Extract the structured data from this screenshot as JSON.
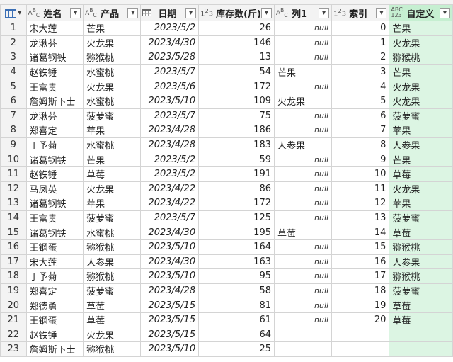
{
  "header": {
    "columns": [
      {
        "label": "姓名",
        "type_icon": "ABC",
        "type_name": "text-type-icon"
      },
      {
        "label": "产品",
        "type_icon": "ABC",
        "type_name": "text-type-icon"
      },
      {
        "label": "日期",
        "type_icon": "calendar",
        "type_name": "date-type-icon"
      },
      {
        "label": "库存数(斤)",
        "type_icon": "123",
        "type_name": "number-type-icon"
      },
      {
        "label": "列1",
        "type_icon": "ABC",
        "type_name": "text-type-icon"
      },
      {
        "label": "索引",
        "type_icon": "123",
        "type_name": "number-type-icon"
      },
      {
        "label": "自定义",
        "type_icon": "ABC123",
        "type_name": "any-type-icon"
      }
    ]
  },
  "null_text": "null",
  "rows": [
    {
      "n": "1",
      "name": "宋大莲",
      "product": "芒果",
      "date": "2023/5/2",
      "qty": "26",
      "col1": "null",
      "idx": "0",
      "custom": "芒果"
    },
    {
      "n": "2",
      "name": "龙湫芬",
      "product": "火龙果",
      "date": "2023/4/30",
      "qty": "146",
      "col1": "null",
      "idx": "1",
      "custom": "火龙果"
    },
    {
      "n": "3",
      "name": "诸葛钢铁",
      "product": "猕猴桃",
      "date": "2023/5/28",
      "qty": "13",
      "col1": "null",
      "idx": "2",
      "custom": "猕猴桃"
    },
    {
      "n": "4",
      "name": "赵铁锤",
      "product": "水蜜桃",
      "date": "2023/5/7",
      "qty": "54",
      "col1": "芒果",
      "idx": "3",
      "custom": "芒果"
    },
    {
      "n": "5",
      "name": "王富贵",
      "product": "火龙果",
      "date": "2023/5/6",
      "qty": "172",
      "col1": "null",
      "idx": "4",
      "custom": "火龙果"
    },
    {
      "n": "6",
      "name": "詹姆斯下士",
      "product": "水蜜桃",
      "date": "2023/5/10",
      "qty": "109",
      "col1": "火龙果",
      "idx": "5",
      "custom": "火龙果"
    },
    {
      "n": "7",
      "name": "龙湫芬",
      "product": "菠萝蜜",
      "date": "2023/5/7",
      "qty": "75",
      "col1": "null",
      "idx": "6",
      "custom": "菠萝蜜"
    },
    {
      "n": "8",
      "name": "郑喜定",
      "product": "苹果",
      "date": "2023/4/28",
      "qty": "186",
      "col1": "null",
      "idx": "7",
      "custom": "苹果"
    },
    {
      "n": "9",
      "name": "于予菊",
      "product": "水蜜桃",
      "date": "2023/4/28",
      "qty": "183",
      "col1": "人参果",
      "idx": "8",
      "custom": "人参果"
    },
    {
      "n": "10",
      "name": "诸葛钢铁",
      "product": "芒果",
      "date": "2023/5/2",
      "qty": "59",
      "col1": "null",
      "idx": "9",
      "custom": "芒果"
    },
    {
      "n": "11",
      "name": "赵铁锤",
      "product": "草莓",
      "date": "2023/5/2",
      "qty": "191",
      "col1": "null",
      "idx": "10",
      "custom": "草莓"
    },
    {
      "n": "12",
      "name": "马凤英",
      "product": "火龙果",
      "date": "2023/4/22",
      "qty": "86",
      "col1": "null",
      "idx": "11",
      "custom": "火龙果"
    },
    {
      "n": "13",
      "name": "诸葛钢铁",
      "product": "苹果",
      "date": "2023/4/22",
      "qty": "172",
      "col1": "null",
      "idx": "12",
      "custom": "苹果"
    },
    {
      "n": "14",
      "name": "王富贵",
      "product": "菠萝蜜",
      "date": "2023/5/7",
      "qty": "125",
      "col1": "null",
      "idx": "13",
      "custom": "菠萝蜜"
    },
    {
      "n": "15",
      "name": "诸葛钢铁",
      "product": "水蜜桃",
      "date": "2023/4/30",
      "qty": "195",
      "col1": "草莓",
      "idx": "14",
      "custom": "草莓"
    },
    {
      "n": "16",
      "name": "王钢蛋",
      "product": "猕猴桃",
      "date": "2023/5/10",
      "qty": "164",
      "col1": "null",
      "idx": "15",
      "custom": "猕猴桃"
    },
    {
      "n": "17",
      "name": "宋大莲",
      "product": "人参果",
      "date": "2023/4/30",
      "qty": "163",
      "col1": "null",
      "idx": "16",
      "custom": "人参果"
    },
    {
      "n": "18",
      "name": "于予菊",
      "product": "猕猴桃",
      "date": "2023/5/10",
      "qty": "95",
      "col1": "null",
      "idx": "17",
      "custom": "猕猴桃"
    },
    {
      "n": "19",
      "name": "郑喜定",
      "product": "菠萝蜜",
      "date": "2023/4/28",
      "qty": "58",
      "col1": "null",
      "idx": "18",
      "custom": "菠萝蜜"
    },
    {
      "n": "20",
      "name": "郑德勇",
      "product": "草莓",
      "date": "2023/5/15",
      "qty": "81",
      "col1": "null",
      "idx": "19",
      "custom": "草莓"
    },
    {
      "n": "21",
      "name": "王钢蛋",
      "product": "草莓",
      "date": "2023/5/15",
      "qty": "61",
      "col1": "null",
      "idx": "20",
      "custom": "草莓"
    },
    {
      "n": "22",
      "name": "赵铁锤",
      "product": "火龙果",
      "date": "2023/5/15",
      "qty": "64",
      "col1": "",
      "idx": "",
      "custom": ""
    },
    {
      "n": "23",
      "name": "詹姆斯下士",
      "product": "猕猴桃",
      "date": "2023/5/10",
      "qty": "25",
      "col1": "",
      "idx": "",
      "custom": ""
    }
  ]
}
